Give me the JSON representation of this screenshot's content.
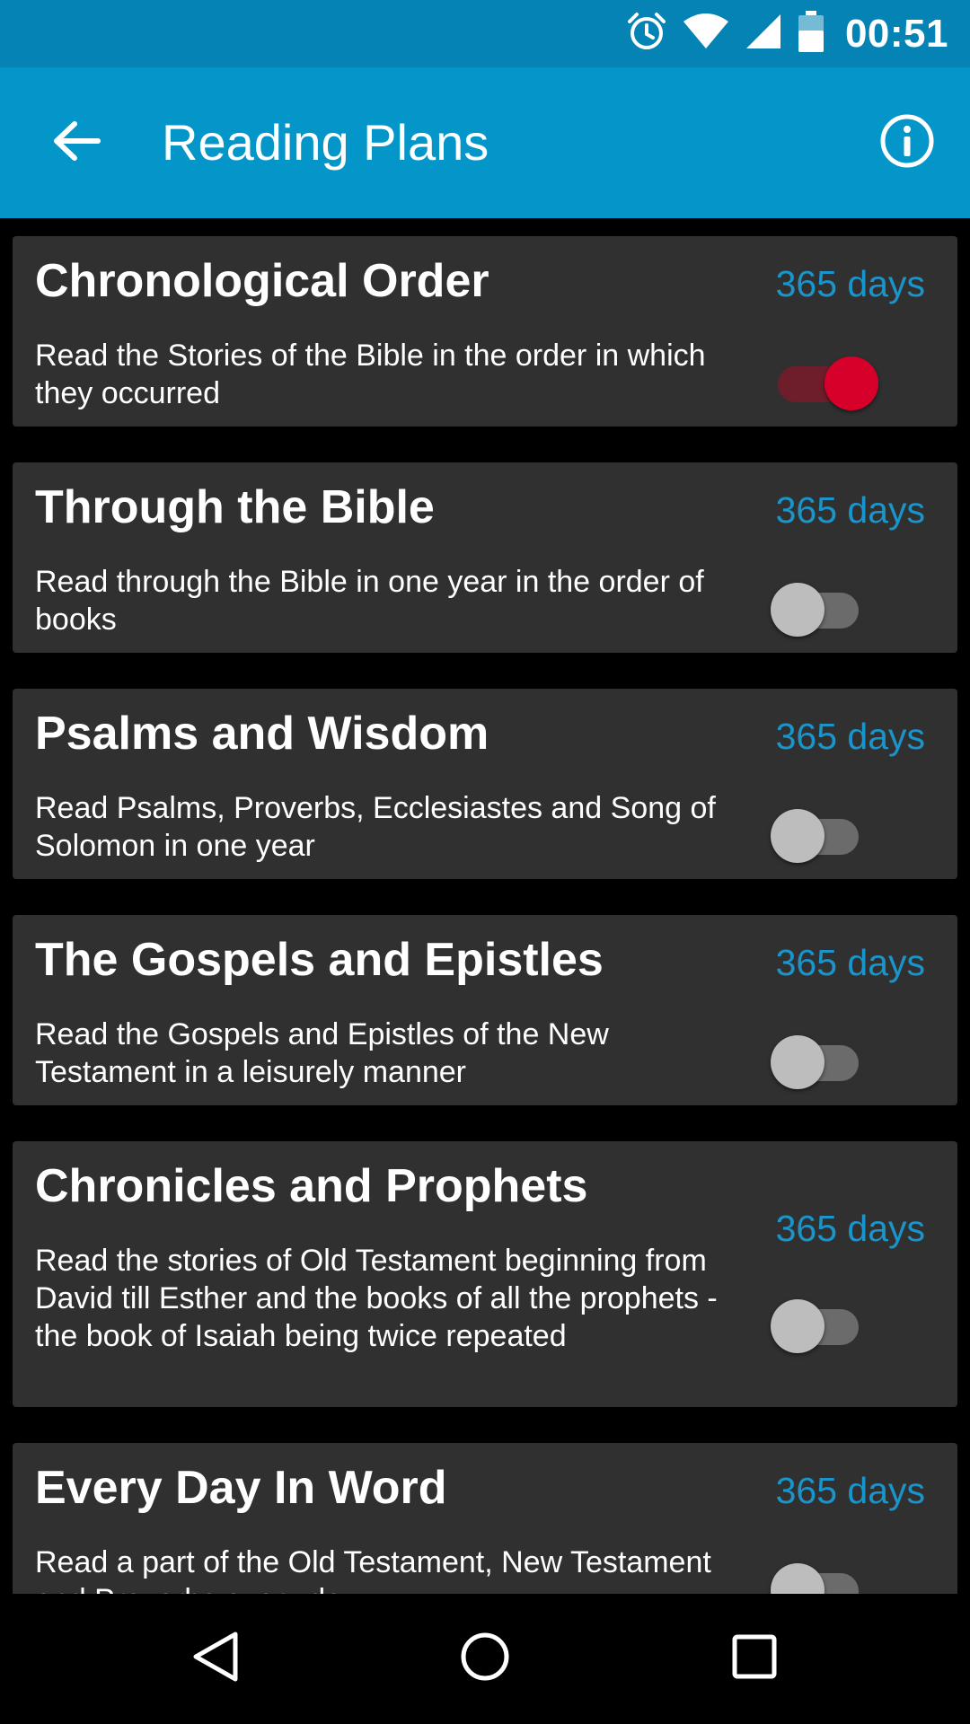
{
  "status_bar": {
    "time": "00:51",
    "icons": [
      "alarm-icon",
      "wifi-icon",
      "signal-icon",
      "battery-icon"
    ]
  },
  "app_bar": {
    "title": "Reading Plans",
    "back_icon": "arrow-back-icon",
    "info_icon": "info-icon"
  },
  "plans": [
    {
      "title": "Chronological Order",
      "days": "365 days",
      "description": "Read the Stories of the Bible in the order in which they occurred",
      "enabled": true
    },
    {
      "title": "Through the Bible",
      "days": "365 days",
      "description": "Read through the Bible in one year in the order of books",
      "enabled": false
    },
    {
      "title": "Psalms and Wisdom",
      "days": "365 days",
      "description": "Read Psalms, Proverbs, Ecclesiastes and Song of Solomon in one year",
      "enabled": false
    },
    {
      "title": "The Gospels and Epistles",
      "days": "365 days",
      "description": "Read the Gospels and Epistles of the New Testament in a leisurely manner",
      "enabled": false
    },
    {
      "title": "Chronicles and Prophets",
      "days": "365 days",
      "description": "Read the stories of Old Testament beginning from David till Esther and the books of all the prophets - the book of Isaiah being twice repeated",
      "enabled": false
    },
    {
      "title": "Every Day In Word",
      "days": "365 days",
      "description": "Read a part of the Old Testament, New Testament and Proverbs every day",
      "enabled": false
    }
  ],
  "nav_bar": {
    "icons": [
      "back-triangle-icon",
      "home-circle-icon",
      "recents-square-icon"
    ]
  },
  "colors": {
    "status_bar": "#0483b4",
    "app_bar": "#0596c9",
    "card": "#303030",
    "days_text": "#1a95cc",
    "switch_on": "#d6002b"
  }
}
